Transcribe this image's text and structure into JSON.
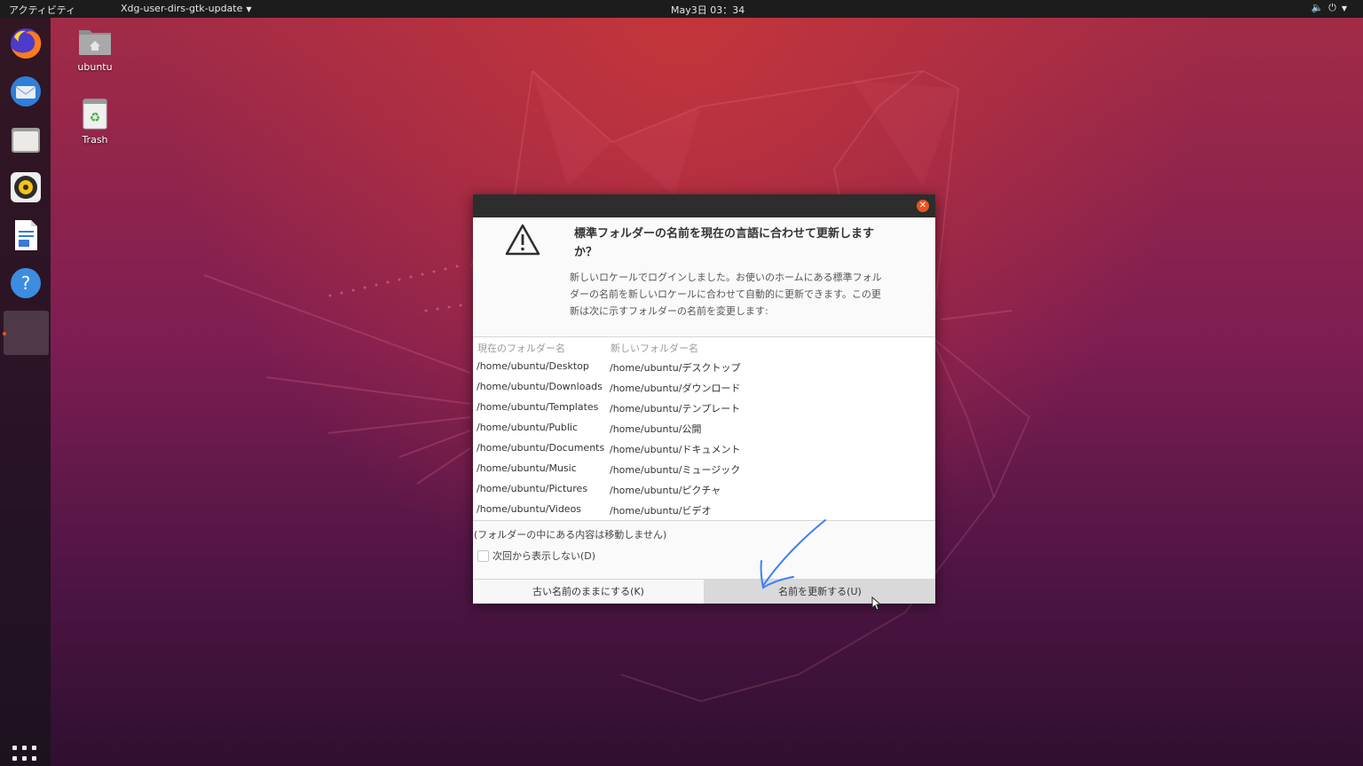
{
  "topbar": {
    "activities": "アクティビティ",
    "app_menu": "Xdg-user-dirs-gtk-update",
    "clock": "May3日  03：34"
  },
  "desktop_icons": {
    "home_label": "ubuntu",
    "trash_label": "Trash"
  },
  "dialog": {
    "heading_line1": "標準フォルダーの名前を現在の言語に合わせて更新します",
    "heading_line2": "か？",
    "body_line1": "新しいロケールでログインしました。お使いのホームにある標準フォル",
    "body_line2": "ダーの名前を新しいロケールに合わせて自動的に更新できます。この更",
    "body_line3": "新は次に示すフォルダーの名前を変更します:",
    "table": {
      "header_old": "現在のフォルダー名",
      "header_new": "新しいフォルダー名",
      "rows": [
        {
          "old": "/home/ubuntu/Desktop",
          "new": "/home/ubuntu/デスクトップ"
        },
        {
          "old": "/home/ubuntu/Downloads",
          "new": "/home/ubuntu/ダウンロード"
        },
        {
          "old": "/home/ubuntu/Templates",
          "new": "/home/ubuntu/テンプレート"
        },
        {
          "old": "/home/ubuntu/Public",
          "new": "/home/ubuntu/公開"
        },
        {
          "old": "/home/ubuntu/Documents",
          "new": "/home/ubuntu/ドキュメント"
        },
        {
          "old": "/home/ubuntu/Music",
          "new": "/home/ubuntu/ミュージック"
        },
        {
          "old": "/home/ubuntu/Pictures",
          "new": "/home/ubuntu/ピクチャ"
        },
        {
          "old": "/home/ubuntu/Videos",
          "new": "/home/ubuntu/ビデオ"
        }
      ]
    },
    "note": "(フォルダーの中にある内容は移動しません)",
    "checkbox_label": "次回から表示しない(D)",
    "checkbox_checked": false,
    "keep_button": "古い名前のままにする(K)",
    "update_button": "名前を更新する(U)"
  },
  "dock": {
    "items": [
      "firefox-icon",
      "thunderbird-icon",
      "files-icon",
      "rhythmbox-icon",
      "libreoffice-writer-icon",
      "help-icon",
      "active-app-icon"
    ],
    "show_apps": "show-applications-icon"
  },
  "colors": {
    "accent": "#e95420",
    "topbar": "#1c1c1c",
    "dialog_titlebar": "#2d2d2d",
    "annotation": "#3d7ff5"
  }
}
